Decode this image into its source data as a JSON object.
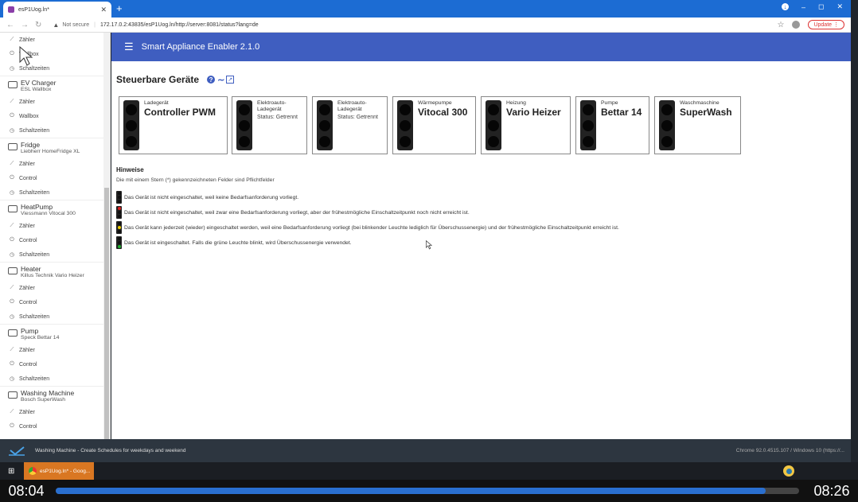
{
  "browser": {
    "tab_title": "esP1Uog.ln*",
    "new_tab": "+",
    "not_secure": "Not secure",
    "url": "172.17.0.2:43835/esP1Uog.ln/http://server:8081/status?lang=de",
    "update_label": "Update",
    "win_min": "–",
    "win_max": "◻",
    "win_close": "✕"
  },
  "sidebar": {
    "partial_top": [
      {
        "icon": "chart-icon",
        "label": "Zähler"
      },
      {
        "icon": "power-icon",
        "label": "Wallbox"
      },
      {
        "icon": "clock-icon",
        "label": "Schaltzeiten"
      }
    ],
    "devices": [
      {
        "name": "EV Charger",
        "sub": "ESL Wallbox",
        "items": [
          "Zähler",
          "Wallbox",
          "Schaltzeiten"
        ]
      },
      {
        "name": "Fridge",
        "sub": "Liebherr HomeFridge XL",
        "items": [
          "Zähler",
          "Control",
          "Schaltzeiten"
        ]
      },
      {
        "name": "HeatPump",
        "sub": "Viessmann Vitocal 300",
        "items": [
          "Zähler",
          "Control",
          "Schaltzeiten"
        ]
      },
      {
        "name": "Heater",
        "sub": "Killus Technik Vario Heizer",
        "items": [
          "Zähler",
          "Control",
          "Schaltzeiten"
        ]
      },
      {
        "name": "Pump",
        "sub": "Speck Bettar 14",
        "items": [
          "Zähler",
          "Control",
          "Schaltzeiten"
        ]
      },
      {
        "name": "Washing Machine",
        "sub": "Bosch SuperWash",
        "items": [
          "Zähler",
          "Control"
        ]
      }
    ]
  },
  "app": {
    "title": "Smart Appliance Enabler 2.1.0"
  },
  "main": {
    "heading": "Steuerbare Geräte",
    "help": "?",
    "cards": [
      {
        "type": "Ladegerät",
        "name": "Controller PWM",
        "status_label": "",
        "status_value": ""
      },
      {
        "type": "Elektroauto-Ladegerät",
        "name": "",
        "status_label": "Status:",
        "status_value": "Getrennt"
      },
      {
        "type": "Elektroauto-Ladegerät",
        "name": "",
        "status_label": "Status:",
        "status_value": "Getrennt"
      },
      {
        "type": "Wärmepumpe",
        "name": "Vitocal 300",
        "status_label": "",
        "status_value": ""
      },
      {
        "type": "Heizung",
        "name": "Vario Heizer",
        "status_label": "",
        "status_value": ""
      },
      {
        "type": "Pumpe",
        "name": "Bettar 14",
        "status_label": "",
        "status_value": ""
      },
      {
        "type": "Waschmaschine",
        "name": "SuperWash",
        "status_label": "",
        "status_value": ""
      }
    ],
    "card_type_lines": [
      [
        "Ladegerät"
      ],
      [
        "Elektroauto-",
        "Ladegerät"
      ],
      [
        "Elektroauto-",
        "Ladegerät"
      ],
      [
        "Wärmepumpe"
      ],
      [
        "Heizung"
      ],
      [
        "Pumpe"
      ],
      [
        "Waschmaschine"
      ]
    ],
    "legend_title": "Hinweise",
    "legend_note": "Die mit einem Stern (*) gekennzeichneten Felder sind Pflichtfelder",
    "legend": [
      {
        "light": "off",
        "text": "Das Gerät ist nicht eingeschaltet, weil keine Bedarfsanforderung vorliegt."
      },
      {
        "light": "red",
        "text": "Das Gerät ist nicht eingeschaltet, weil zwar eine Bedarfsanforderung vorliegt, aber der frühestmögliche Einschaltzeitpunkt noch nicht erreicht ist."
      },
      {
        "light": "yellow",
        "text": "Das Gerät kann jederzeit (wieder) eingeschaltet werden, weil eine Bedarfsanforderung vorliegt (bei blinkender Leuchte lediglich für Überschussenergie) und der frühestmögliche Einschaltzeitpunkt erreicht ist."
      },
      {
        "light": "green",
        "text": "Das Gerät ist eingeschaltet. Falls die grüne Leuchte blinkt, wird Überschussenergie verwendet."
      }
    ],
    "colors": {
      "red": "#e02020",
      "yellow": "#f0d000",
      "green": "#20b030",
      "off": "#111111"
    }
  },
  "videobar": {
    "title": "Washing Machine - Create Schedules for weekdays and weekend",
    "right": "Chrome 92.0.4515.107 / Windows 10 (https://..."
  },
  "taskbar": {
    "task_label": "esP1Uog.ln* - Goog..."
  },
  "player": {
    "current": "08:04",
    "total": "08:26",
    "progress": 0.955
  }
}
